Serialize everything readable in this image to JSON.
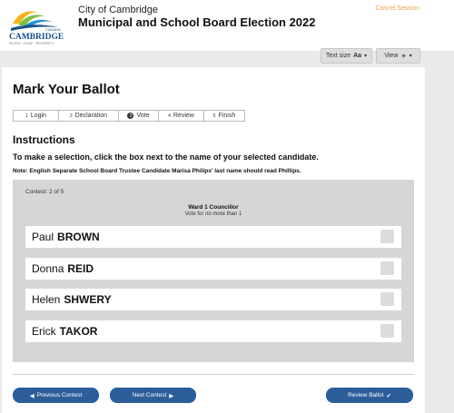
{
  "header": {
    "logo_text": "CAMBRIDGE",
    "logo_canada": "CANADA",
    "logo_tagline": "PEOPLE · PLACE · PROSPERITY",
    "city": "City of Cambridge",
    "election": "Municipal and School Board Election 2022",
    "cancel": "Cancel Session"
  },
  "toolbar": {
    "text_size": "Text size",
    "text_size_icon": "Aa",
    "view": "View",
    "view_icon": "☀",
    "caret": "▾"
  },
  "page": {
    "title": "Mark Your Ballot",
    "steps": [
      {
        "label": "Login",
        "num": "1"
      },
      {
        "label": "Declaration",
        "num": "2"
      },
      {
        "label": "Vote",
        "num": "3"
      },
      {
        "label": "Review",
        "num": "4"
      },
      {
        "label": "Finish",
        "num": "5"
      }
    ],
    "instructions_title": "Instructions",
    "instructions_text": "To make a selection, click the box next to the name of your selected candidate.",
    "note": "Note: English Separate School Board Trustee Candidate Marisa Philips' last name should read Phillips."
  },
  "contest": {
    "count": "Contest: 2 of 5",
    "title": "Ward 1 Councillor",
    "subtitle": "Vote for no more than 1",
    "candidates": [
      {
        "first": "Paul",
        "last": "BROWN"
      },
      {
        "first": "Donna",
        "last": "REID"
      },
      {
        "first": "Helen",
        "last": "SHWERY"
      },
      {
        "first": "Erick",
        "last": "TAKOR"
      }
    ]
  },
  "nav": {
    "prev": "Previous Contest",
    "next": "Next Contest",
    "review": "Review Ballot"
  },
  "colors": {
    "accent": "#2c5e9a",
    "cancel": "#e8a24a"
  }
}
